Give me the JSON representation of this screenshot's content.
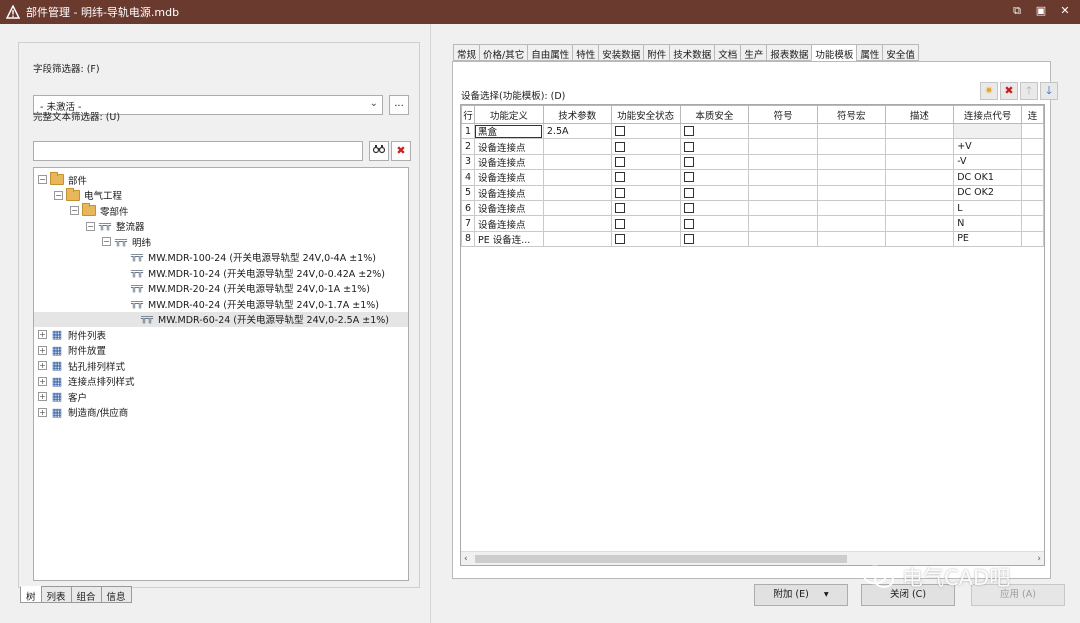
{
  "window": {
    "title": "部件管理 - 明纬-导轨电源.mdb"
  },
  "left": {
    "field_filter_label": "字段筛选器: (F)",
    "field_filter_value": "- 未激活 -",
    "dots_label": "...",
    "text_filter_label": "完整文本筛选器: (U)",
    "tree": [
      {
        "label": "部件",
        "level": 0,
        "type": "folder",
        "exp": "−"
      },
      {
        "label": "电气工程",
        "level": 1,
        "type": "folder",
        "exp": "−"
      },
      {
        "label": "零部件",
        "level": 2,
        "type": "folder",
        "exp": "−"
      },
      {
        "label": "整流器",
        "level": 3,
        "type": "part",
        "exp": "−"
      },
      {
        "label": "明纬",
        "level": 4,
        "type": "part",
        "exp": "−"
      },
      {
        "label": "MW.MDR-100-24 (开关电源导轨型 24V,0-4A ±1%)",
        "level": 5,
        "type": "part"
      },
      {
        "label": "MW.MDR-10-24 (开关电源导轨型 24V,0-0.42A ±2%)",
        "level": 5,
        "type": "part"
      },
      {
        "label": "MW.MDR-20-24 (开关电源导轨型 24V,0-1A ±1%)",
        "level": 5,
        "type": "part"
      },
      {
        "label": "MW.MDR-40-24 (开关电源导轨型 24V,0-1.7A ±1%)",
        "level": 5,
        "type": "part"
      },
      {
        "label": "MW.MDR-60-24 (开关电源导轨型 24V,0-2.5A ±1%)",
        "level": 5,
        "type": "part",
        "selected": true
      },
      {
        "label": "附件列表",
        "level": 0,
        "type": "blue",
        "exp": "+"
      },
      {
        "label": "附件放置",
        "level": 0,
        "type": "blue",
        "exp": "+"
      },
      {
        "label": "钻孔排列样式",
        "level": 0,
        "type": "blue",
        "exp": "+"
      },
      {
        "label": "连接点排列样式",
        "level": 0,
        "type": "blue",
        "exp": "+"
      },
      {
        "label": "客户",
        "level": 0,
        "type": "blue",
        "exp": "+"
      },
      {
        "label": "制造商/供应商",
        "level": 0,
        "type": "blue",
        "exp": "+"
      }
    ],
    "bottom_tabs": [
      "树",
      "列表",
      "组合",
      "信息"
    ]
  },
  "right": {
    "tabs": [
      "常规",
      "价格/其它",
      "自由属性",
      "特性",
      "安装数据",
      "附件",
      "技术数据",
      "文档",
      "生产",
      "报表数据",
      "功能模板",
      "属性",
      "安全值"
    ],
    "active_tab": "功能模板",
    "selection_label": "设备选择(功能模板): (D)",
    "columns": [
      "行",
      "功能定义",
      "技术参数",
      "功能安全状态",
      "本质安全",
      "符号",
      "符号宏",
      "描述",
      "连接点代号",
      "连"
    ],
    "rows": [
      {
        "n": "1",
        "func": "黑盒",
        "tech": "2.5A",
        "conn": ""
      },
      {
        "n": "2",
        "func": "设备连接点",
        "tech": "",
        "conn": "+V"
      },
      {
        "n": "3",
        "func": "设备连接点",
        "tech": "",
        "conn": "-V"
      },
      {
        "n": "4",
        "func": "设备连接点",
        "tech": "",
        "conn": "DC OK1"
      },
      {
        "n": "5",
        "func": "设备连接点",
        "tech": "",
        "conn": "DC OK2"
      },
      {
        "n": "6",
        "func": "设备连接点",
        "tech": "",
        "conn": "L"
      },
      {
        "n": "7",
        "func": "设备连接点",
        "tech": "",
        "conn": "N"
      },
      {
        "n": "8",
        "func": "PE 设备连...",
        "tech": "",
        "conn": "PE"
      }
    ],
    "buttons": {
      "add": "附加 (E)",
      "close": "关闭 (C)",
      "apply": "应用 (A)"
    }
  },
  "watermark": {
    "text": "电气CAD吧"
  },
  "colors": {
    "titlebar": "#6b3a2f",
    "accent_orange": "#e8a020",
    "delete_red": "#cc2020",
    "arrow_blue": "#2060c0"
  }
}
